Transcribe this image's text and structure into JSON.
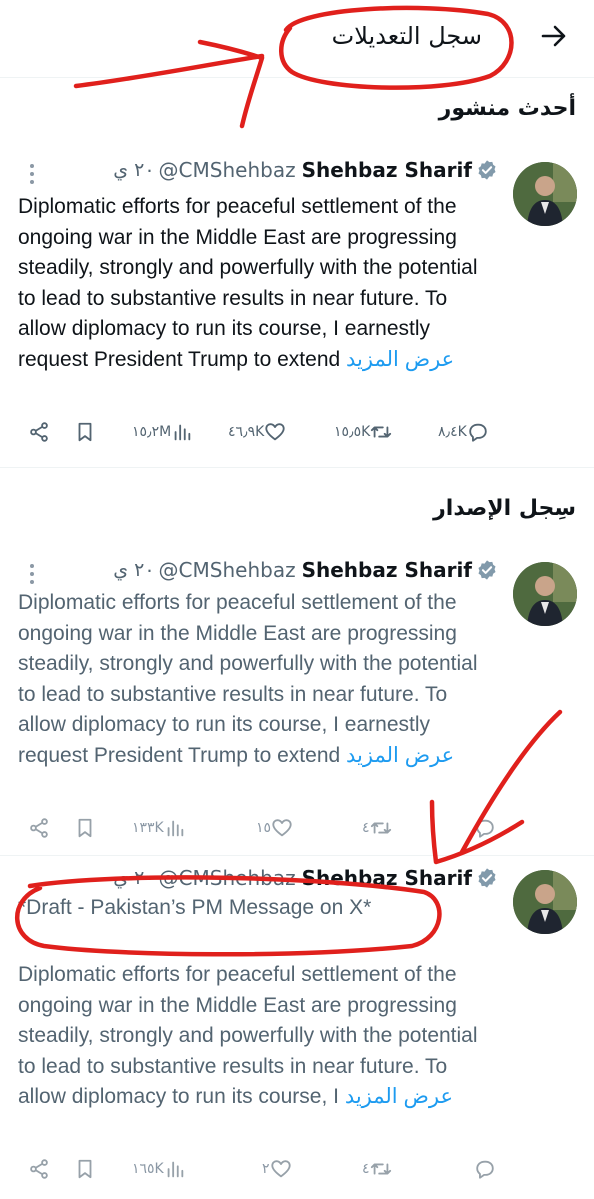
{
  "header": {
    "title": "سجل التعديلات",
    "back_icon": "arrow-right-icon"
  },
  "latest_section": {
    "title": "أحدث منشور"
  },
  "history_section": {
    "title": "سِجل الإصدار"
  },
  "tweets": [
    {
      "name": "Shehbaz Sharif",
      "handle": "@CMShehbaz",
      "time": "٢٠ ي",
      "text": "Diplomatic efforts for peaceful settlement of the ongoing war in the Middle East are progressing steadily, strongly and powerfully with the potential to lead to substantive results in near future. To allow diplomacy to run its course, I earnestly request President Trump to extend",
      "show_more": "عرض المزيد",
      "stats": {
        "replies": "٨٫٤K",
        "reposts": "١٥٫٥K",
        "likes": "٤٦٫٩K",
        "views": "١٥٫٢M"
      }
    },
    {
      "name": "Shehbaz Sharif",
      "handle": "@CMShehbaz",
      "time": "٢٠ ي",
      "text": "Diplomatic efforts for peaceful settlement of the ongoing war in the Middle East are progressing steadily, strongly and powerfully with the potential to lead to substantive results in near future. To allow diplomacy to run its course, I earnestly request President Trump to extend",
      "show_more": "عرض المزيد",
      "stats": {
        "replies": "",
        "reposts": "٤",
        "likes": "١٥",
        "views": "١٣٣K"
      }
    },
    {
      "name": "Shehbaz Sharif",
      "handle": "@CMShehbaz",
      "time": "٢٠ ي",
      "draft_line": "*Draft - Pakistan’s PM Message on X*",
      "text": "Diplomatic efforts for peaceful settlement of the ongoing war in the Middle East are progressing steadily, strongly and powerfully with the potential to lead to substantive results in near future. To allow diplomacy to run its course, I",
      "show_more": "عرض المزيد",
      "stats": {
        "replies": "",
        "reposts": "٤",
        "likes": "٢",
        "views": "١٦٥K"
      }
    }
  ],
  "colors": {
    "link": "#1d9bf0",
    "verified": "#829aab",
    "annotation": "#e0201c"
  }
}
